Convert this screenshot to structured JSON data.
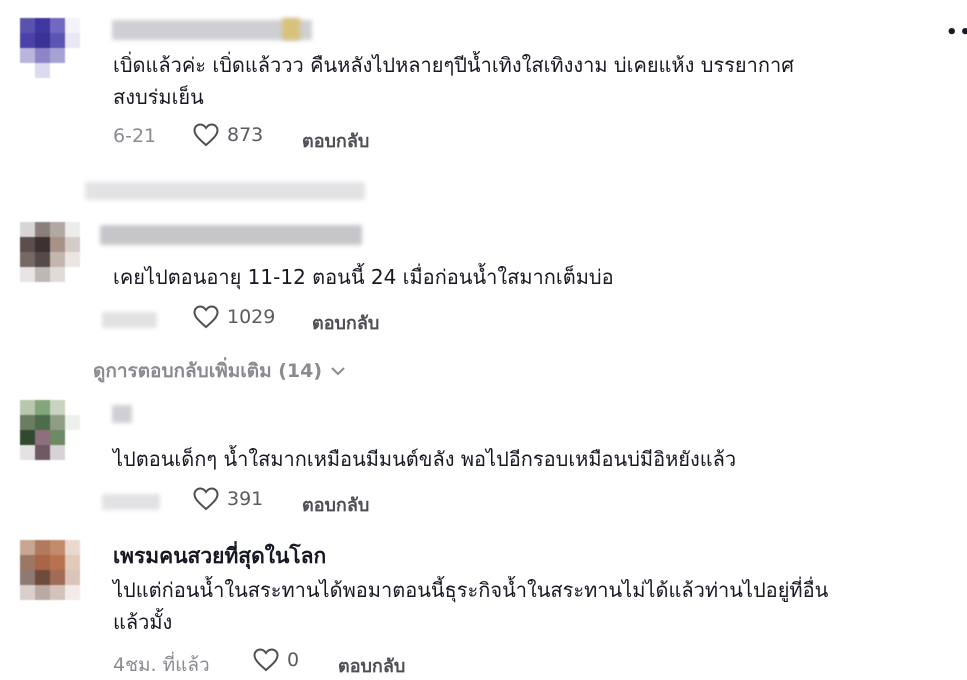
{
  "comments": [
    {
      "text_line1": "เบิ่ดแล้วค่ะ เบิ่ดแล้ววว คืนหลังไปหลายๆปีน้ำเทิงใสเทิงงาม บ่เคยแห้ง บรรยากาศ",
      "text_line2": "สงบร่มเย็น",
      "date": "6-21",
      "likes": "873",
      "reply_label": "ตอบกลับ"
    },
    {
      "text_line1": "เคยไปตอนอายุ 11-12 ตอนนี้ 24 เมื่อก่อนน้ำใสมากเต็มบ่อ",
      "likes": "1029",
      "reply_label": "ตอบกลับ",
      "more_replies": "ดูการตอบกลับเพิ่มเติม (14)"
    },
    {
      "text_line1": "ไปตอนเด็กๆ น้ำใสมากเหมือนมีมนต์ขลัง พอไปอีกรอบเหมือนบ่มีอิหยังแล้ว",
      "likes": "391",
      "reply_label": "ตอบกลับ"
    },
    {
      "username": "เพรมคนสวยที่สุดในโลก",
      "text_line1": "ไปแต่ก่อนน้ำในสระทานได้พอมาตอนนี้ธุระกิจน้ำในสระทานไม่ได้แล้วท่านไปอยู่ที่อื่น",
      "text_line2": "แล้วมั้ง",
      "date": "4ชม. ที่แล้ว",
      "likes": "0",
      "reply_label": "ตอบกลับ"
    }
  ],
  "icons": {
    "like": "heart-outline-icon",
    "expand": "chevron-down-icon",
    "more": "more-dots-icon"
  },
  "colors": {
    "text": "#161823",
    "muted": "#8a8b91",
    "reply": "#4e4f55"
  }
}
